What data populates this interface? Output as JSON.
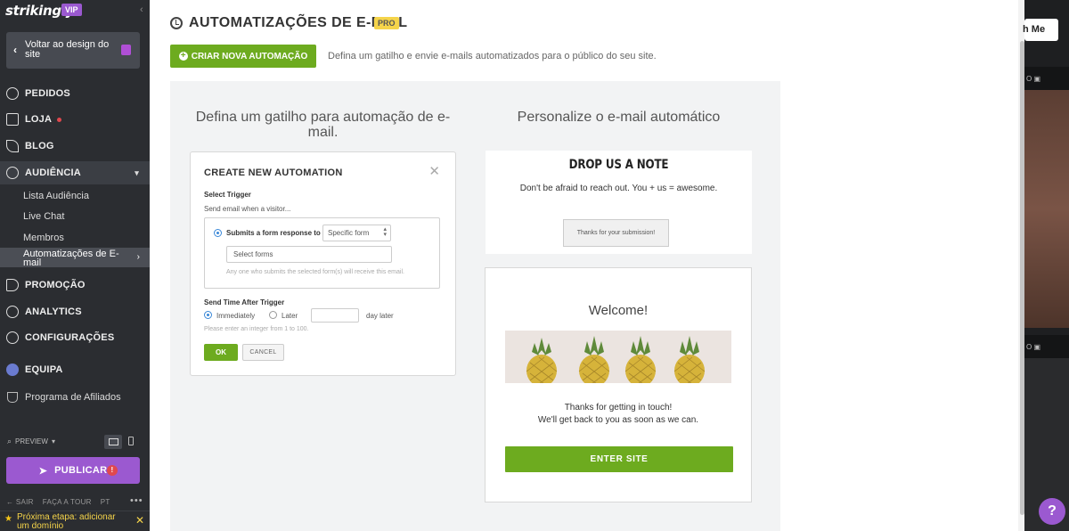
{
  "sidebar": {
    "logo": "strikingly",
    "vip_badge": "VIP",
    "back_button": "Voltar ao design do site",
    "nav": {
      "orders": "PEDIDOS",
      "store": "LOJA",
      "blog": "BLOG",
      "audience": "AUDIÊNCIA",
      "promotion": "PROMOÇÃO",
      "analytics": "ANALYTICS",
      "settings": "CONFIGURAÇÕES",
      "team": "EQUIPA",
      "affiliate": "Programa de Afiliados"
    },
    "audience_sub": {
      "list": "Lista Audiência",
      "chat": "Live Chat",
      "members": "Membros",
      "automations": "Automatizações de E-mail"
    },
    "preview_label": "PREVIEW",
    "publish_label": "PUBLICAR",
    "footer": {
      "exit": "SAIR",
      "tour": "FAÇA A TOUR",
      "lang": "PT",
      "more": "•••"
    },
    "next_step": "Próxima etapa: adicionar um domínio"
  },
  "page": {
    "title": "AUTOMATIZAÇÕES DE E-MAIL",
    "pro_badge": "PRO",
    "create_button": "CRIAR NOVA AUTOMAÇÃO",
    "description": "Defina um gatilho e envie e-mails automatizados para o público do seu site.",
    "left_title": "Defina um gatilho para automação de e-mail.",
    "right_title": "Personalize o e-mail automático"
  },
  "form": {
    "title": "CREATE NEW AUTOMATION",
    "select_trigger": "Select Trigger",
    "send_when": "Send email when a visitor...",
    "option_label": "Submits a form response to",
    "select_value": "Specific form",
    "forms_placeholder": "Select forms",
    "forms_hint": "Any one who submits the selected form(s) will receive this email.",
    "send_time": "Send Time After Trigger",
    "immediately": "Immediately",
    "later": "Later",
    "day_later": "day later",
    "integer_hint": "Please enter an integer  from 1 to 100.",
    "ok": "OK",
    "cancel": "CANCEL"
  },
  "preview_note": {
    "title": "DROP US A NOTE",
    "subtitle": "Don't be afraid to reach out. You + us = awesome.",
    "thanks": "Thanks for your submission!"
  },
  "preview_email": {
    "welcome": "Welcome!",
    "line1": "Thanks for getting in touch!",
    "line2": "We'll get back to you as soon as we can.",
    "button": "ENTER SITE"
  },
  "background": {
    "button_fragment": "h Me",
    "bar_fragment": "O"
  },
  "colors": {
    "sidebar": "#2b2d31",
    "accent_green": "#6dab1f",
    "brand_purple": "#9b59d0",
    "pro_yellow": "#f5d44a"
  }
}
